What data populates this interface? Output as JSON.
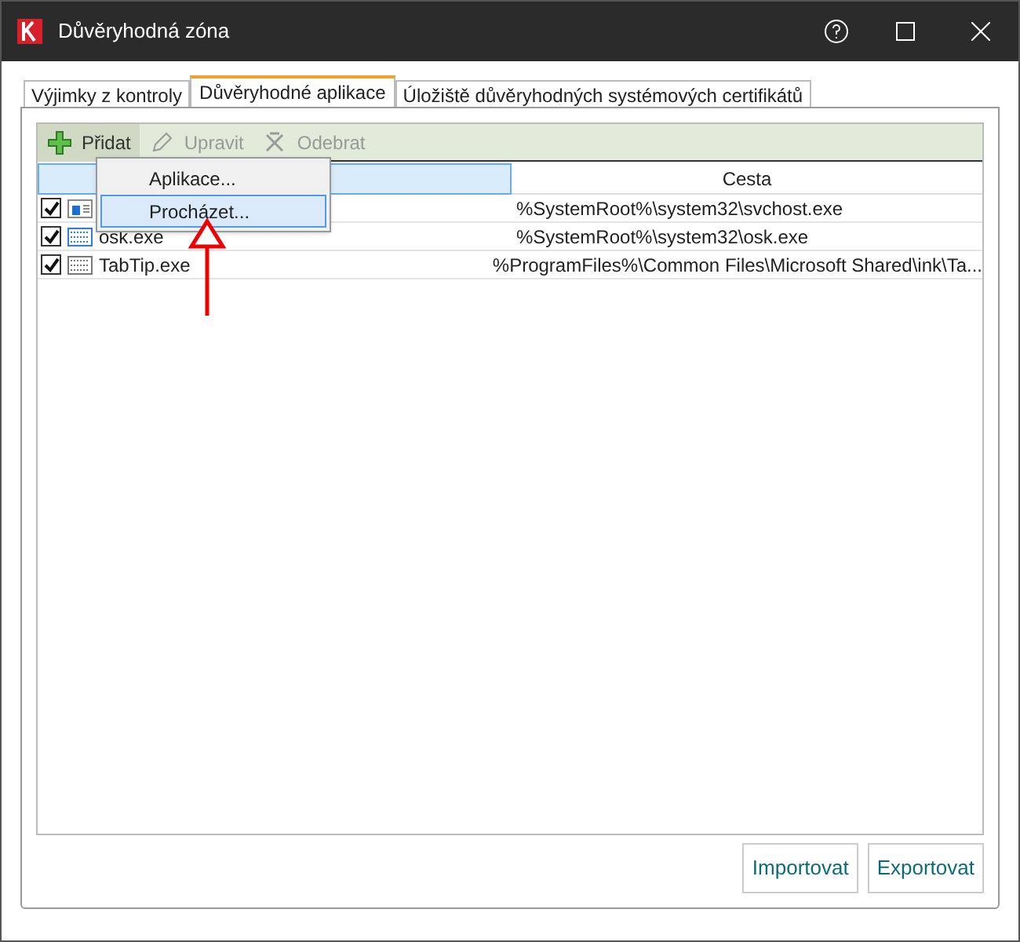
{
  "window": {
    "title": "Důvěryhodná zóna"
  },
  "tabs": [
    {
      "label": "Výjimky z kontroly",
      "selected": false
    },
    {
      "label": "Důvěryhodné aplikace",
      "selected": true
    },
    {
      "label": "Úložiště důvěryhodných systémových certifikátů",
      "selected": false
    }
  ],
  "toolbar": [
    {
      "label": "Přidat",
      "kind": "add",
      "disabled": false
    },
    {
      "label": "Upravit",
      "kind": "edit",
      "disabled": true
    },
    {
      "label": "Odebrat",
      "kind": "remove",
      "disabled": true
    }
  ],
  "menu": [
    {
      "label": "Aplikace...",
      "selected": false
    },
    {
      "label": "Procházet...",
      "selected": true
    }
  ],
  "table": {
    "columns": [
      "Cesta"
    ],
    "rows": [
      {
        "checked": true,
        "kind": "window",
        "path": "%SystemRoot%\\system32\\svchost.exe"
      },
      {
        "checked": true,
        "kind": "keyboard-blue",
        "name": "osk.exe",
        "path": "%SystemRoot%\\system32\\osk.exe"
      },
      {
        "checked": true,
        "kind": "keyboard-grey",
        "name": "TabTip.exe",
        "path": "%ProgramFiles%\\Common Files\\Microsoft Shared\\ink\\Ta..."
      }
    ]
  },
  "buttons": [
    "Importovat",
    "Exportovat"
  ]
}
